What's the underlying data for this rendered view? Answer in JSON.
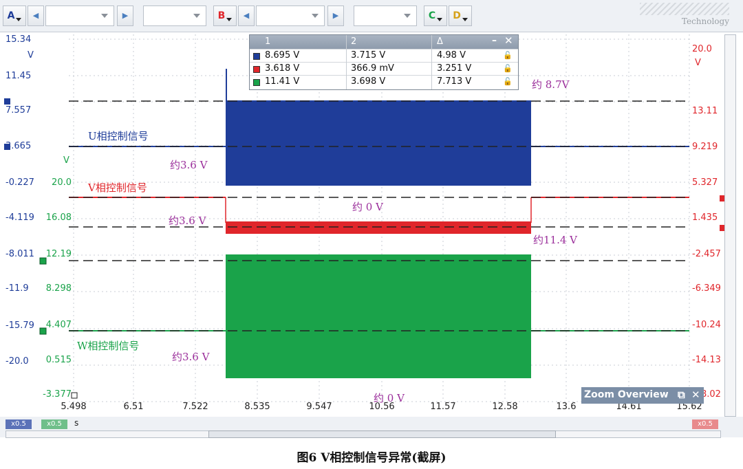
{
  "toolbar": {
    "channel_a": "A",
    "channel_b": "B",
    "channel_c": "C",
    "channel_d": "D",
    "logo_text": "Technology"
  },
  "measurements": {
    "headers": [
      "1",
      "2",
      "Δ"
    ],
    "rows": [
      {
        "color": "#1f3d99",
        "v1": "8.695 V",
        "v2": "3.715 V",
        "delta": "4.98 V"
      },
      {
        "color": "#e0262b",
        "v1": "3.618 V",
        "v2": "366.9 mV",
        "delta": "3.251 V"
      },
      {
        "color": "#1aa34a",
        "v1": "11.41 V",
        "v2": "3.698 V",
        "delta": "7.713 V"
      }
    ]
  },
  "axes": {
    "left_a_ticks": [
      "15.34",
      "11.45",
      "7.557",
      "3.665",
      "-0.227",
      "-4.119",
      "-8.011",
      "-11.9",
      "-15.79",
      "-20.0"
    ],
    "left_a_unit": "V",
    "left_c_ticks": [
      "20.0",
      "16.08",
      "12.19",
      "8.298",
      "4.407",
      "0.515",
      "-3.377"
    ],
    "left_c_unit": "V",
    "right_b_ticks": [
      "20.0",
      "13.11",
      "9.219",
      "5.327",
      "1.435",
      "-2.457",
      "-6.349",
      "-10.24",
      "-14.13",
      "-18.02"
    ],
    "right_b_unit": "V",
    "x_ticks": [
      "5.498",
      "6.51",
      "7.522",
      "8.535",
      "9.547",
      "10.56",
      "11.57",
      "12.58",
      "13.6",
      "14.61",
      "15.62"
    ],
    "x_unit": "s",
    "scale_badges": [
      "x0.5",
      "x0.5",
      "x0.5"
    ]
  },
  "annotations": {
    "u_label": "U相控制信号",
    "v_label": "V相控制信号",
    "w_label": "W相控制信号",
    "u_low": "约3.6 V",
    "v_low": "约3.6 V",
    "w_low": "约3.6 V",
    "u_high": "约 8.7V",
    "v_zero": "约 0 V",
    "w_high": "约11.4 V",
    "w_zero": "约 0 V"
  },
  "zoom_overview": {
    "title": "Zoom Overview",
    "restore_icon": "restore-icon",
    "close_icon": "close-icon"
  },
  "caption": "图6 V相控制信号异常(截屏)",
  "colors": {
    "u": "#1f3d99",
    "v": "#e0262b",
    "w": "#1aa34a",
    "annotation": "#9b2f9b"
  }
}
